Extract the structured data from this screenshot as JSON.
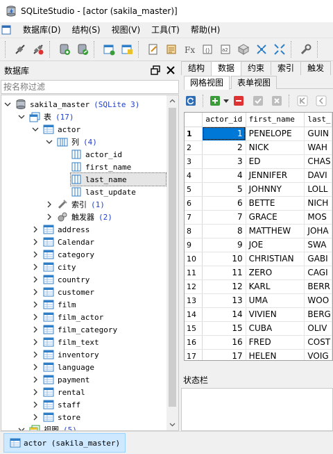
{
  "window": {
    "title": "SQLiteStudio - [actor (sakila_master)]"
  },
  "menu": [
    "数据库(D)",
    "结构(S)",
    "视图(V)",
    "工具(T)",
    "帮助(H)"
  ],
  "toolbar_icons": [
    "connect-icon",
    "disconnect-icon",
    "add-database-icon",
    "edit-database-icon",
    "create-table-icon",
    "edit-table-icon",
    "sql-editor-icon",
    "ddl-history-icon",
    "functions-icon",
    "collations-icon",
    "extensions-icon",
    "import-icon",
    "export-icon",
    "tile-windows-icon",
    "cascade-windows-icon",
    "settings-icon"
  ],
  "db_panel": {
    "header": "数据库",
    "filter_placeholder": "按名称过滤",
    "database": {
      "name": "sakila_master",
      "version": "(SQLite 3)"
    },
    "tables_label": "表",
    "tables_count": "(17)",
    "actor": {
      "name": "actor",
      "columns_label": "列",
      "columns_count": "(4)"
    },
    "columns": [
      "actor_id",
      "first_name",
      "last_name",
      "last_update"
    ],
    "indexes_label": "索引",
    "indexes_count": "(1)",
    "triggers_label": "触发器",
    "triggers_count": "(2)",
    "tables": [
      "address",
      "Calendar",
      "category",
      "city",
      "country",
      "customer",
      "film",
      "film_actor",
      "film_category",
      "film_text",
      "inventory",
      "language",
      "payment",
      "rental",
      "staff",
      "store"
    ],
    "views_label": "视图",
    "views_count": "(5)"
  },
  "tabs": [
    "结构",
    "数据",
    "约束",
    "索引",
    "触发"
  ],
  "subtabs": [
    "网格视图",
    "表单视图"
  ],
  "grid": {
    "columns": [
      "actor_id",
      "first_name",
      "last_"
    ],
    "rows": [
      [
        "1",
        "PENELOPE",
        "GUIN"
      ],
      [
        "2",
        "NICK",
        "WAH"
      ],
      [
        "3",
        "ED",
        "CHAS"
      ],
      [
        "4",
        "JENNIFER",
        "DAVI"
      ],
      [
        "5",
        "JOHNNY",
        "LOLL"
      ],
      [
        "6",
        "BETTE",
        "NICH"
      ],
      [
        "7",
        "GRACE",
        "MOS"
      ],
      [
        "8",
        "MATTHEW",
        "JOHA"
      ],
      [
        "9",
        "JOE",
        "SWA"
      ],
      [
        "10",
        "CHRISTIAN",
        "GABI"
      ],
      [
        "11",
        "ZERO",
        "CAGI"
      ],
      [
        "12",
        "KARL",
        "BERR"
      ],
      [
        "13",
        "UMA",
        "WOO"
      ],
      [
        "14",
        "VIVIEN",
        "BERG"
      ],
      [
        "15",
        "CUBA",
        "OLIV"
      ],
      [
        "16",
        "FRED",
        "COST"
      ],
      [
        "17",
        "HELEN",
        "VOIG"
      ]
    ]
  },
  "status": {
    "label": "状态栏"
  },
  "taskbar": {
    "item": "actor (sakila_master)"
  }
}
